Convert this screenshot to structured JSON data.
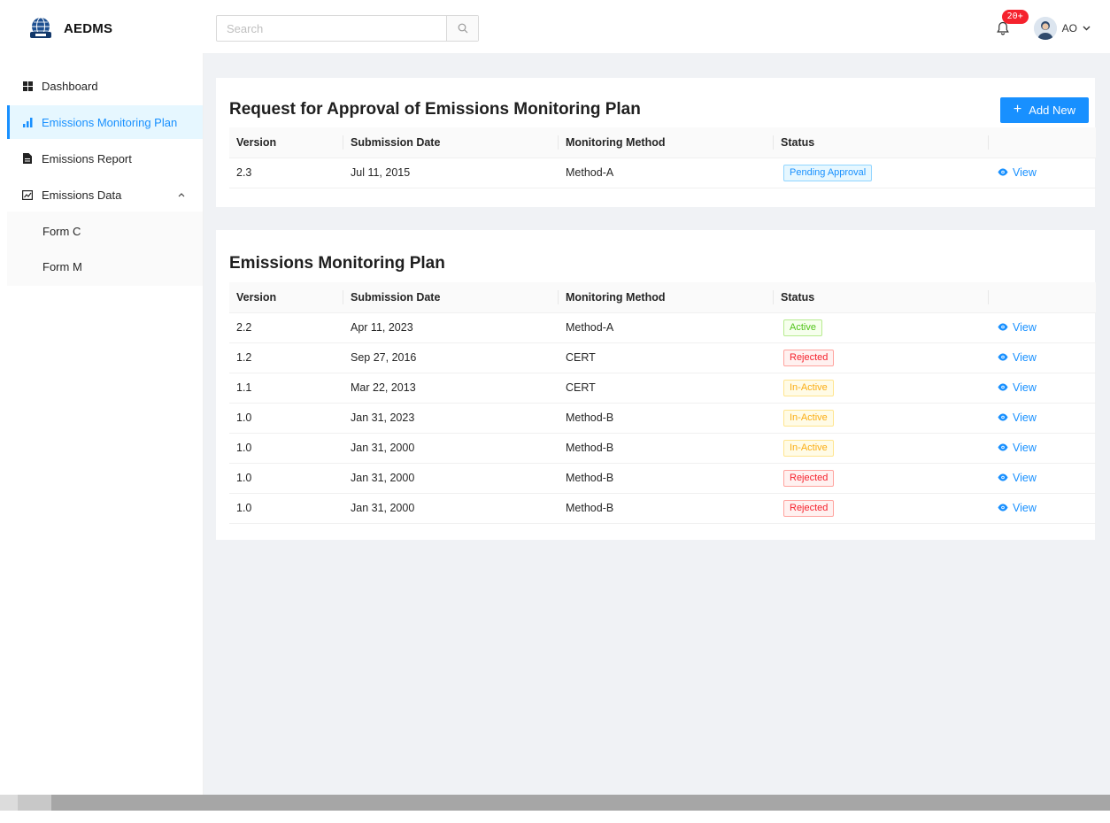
{
  "app": {
    "name": "AEDMS"
  },
  "header": {
    "search_placeholder": "Search",
    "notification_count": "20+",
    "user_initials": "AO"
  },
  "sidebar": {
    "items": [
      {
        "label": "Dashboard",
        "icon": "dashboard-icon"
      },
      {
        "label": "Emissions Monitoring Plan",
        "icon": "bar-chart-icon",
        "active": true
      },
      {
        "label": "Emissions Report",
        "icon": "file-icon"
      },
      {
        "label": "Emissions Data",
        "icon": "line-chart-icon",
        "expanded": true
      }
    ],
    "sub_items": [
      {
        "label": "Form C"
      },
      {
        "label": "Form M"
      }
    ]
  },
  "requests": {
    "title": "Request for Approval of Emissions Monitoring Plan",
    "add_label": "Add New",
    "columns": [
      "Version",
      "Submission Date",
      "Monitoring Method",
      "Status",
      ""
    ],
    "rows": [
      {
        "version": "2.3",
        "date": "Jul 11, 2015",
        "method": "Method-A",
        "status": "Pending Approval",
        "action": "View"
      }
    ]
  },
  "plans": {
    "title": "Emissions Monitoring Plan",
    "columns": [
      "Version",
      "Submission Date",
      "Monitoring Method",
      "Status",
      ""
    ],
    "rows": [
      {
        "version": "2.2",
        "date": "Apr 11, 2023",
        "method": "Method-A",
        "status": "Active",
        "action": "View"
      },
      {
        "version": "1.2",
        "date": "Sep 27, 2016",
        "method": "CERT",
        "status": "Rejected",
        "action": "View"
      },
      {
        "version": "1.1",
        "date": "Mar 22, 2013",
        "method": "CERT",
        "status": "In-Active",
        "action": "View"
      },
      {
        "version": "1.0",
        "date": "Jan 31, 2023",
        "method": "Method-B",
        "status": "In-Active",
        "action": "View"
      },
      {
        "version": "1.0",
        "date": "Jan 31, 2000",
        "method": "Method-B",
        "status": "In-Active",
        "action": "View"
      },
      {
        "version": "1.0",
        "date": "Jan 31, 2000",
        "method": "Method-B",
        "status": "Rejected",
        "action": "View"
      },
      {
        "version": "1.0",
        "date": "Jan 31, 2000",
        "method": "Method-B",
        "status": "Rejected",
        "action": "View"
      }
    ]
  },
  "colors": {
    "primary": "#1890ff",
    "pending": "#1890ff",
    "active": "#52c41a",
    "rejected": "#f5222d",
    "inactive": "#faad14"
  }
}
